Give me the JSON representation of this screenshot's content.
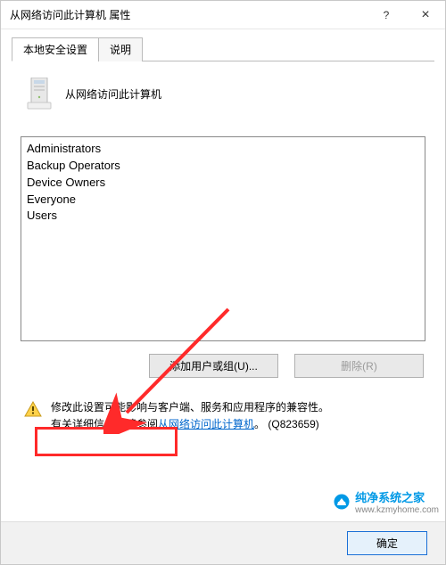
{
  "titlebar": {
    "title": "从网络访问此计算机 属性",
    "help": "?",
    "close": "×"
  },
  "tabs": {
    "local": "本地安全设置",
    "explain": "说明"
  },
  "header": {
    "heading": "从网络访问此计算机"
  },
  "list": {
    "items": [
      "Administrators",
      "Backup Operators",
      "Device Owners",
      "Everyone",
      "Users"
    ]
  },
  "buttons": {
    "add": "添加用户或组(U)...",
    "remove": "删除(R)"
  },
  "info": {
    "line1": "修改此设置可能影响与客户端、服务和应用程序的兼容性。",
    "line2_prefix": "有关详细信息，请参阅",
    "link": "从网络访问此计算机",
    "line2_suffix": "。 (Q823659)"
  },
  "footer": {
    "ok": "确定"
  },
  "watermark": {
    "name": "纯净系统之家",
    "url": "www.kzmyhome.com"
  }
}
